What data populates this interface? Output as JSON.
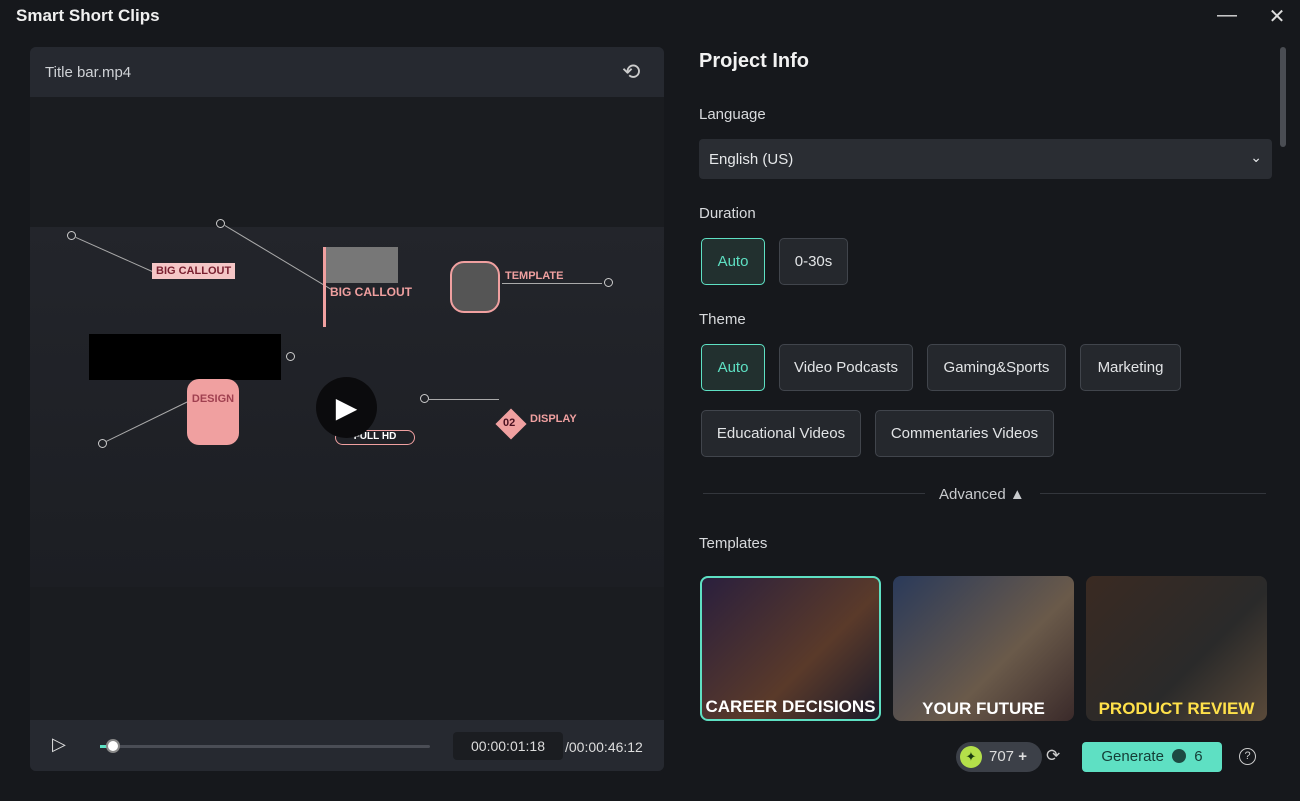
{
  "window": {
    "title": "Smart Short Clips",
    "minimize": "—",
    "close": "✕"
  },
  "preview": {
    "filename": "Title bar.mp4",
    "current_time": "00:00:01:18",
    "total_time": "/00:00:46:12",
    "progress": 0.04,
    "overlay_labels": {
      "callout1": "BIG CALLOUT",
      "callout2": "BIG CALLOUT",
      "template": "TEMPLATE",
      "design": "DESIGN",
      "fullhd": "FULL HD",
      "num": "02",
      "display": "DISPLAY"
    }
  },
  "project": {
    "title": "Project Info",
    "language": {
      "label": "Language",
      "value": "English (US)"
    },
    "duration": {
      "label": "Duration",
      "options": [
        "Auto",
        "0-30s"
      ],
      "selected": "Auto"
    },
    "theme": {
      "label": "Theme",
      "options": [
        "Auto",
        "Video Podcasts",
        "Gaming&Sports",
        "Marketing",
        "Educational Videos",
        "Commentaries Videos"
      ],
      "selected": "Auto"
    },
    "advanced": "Advanced ▲",
    "templates": {
      "label": "Templates",
      "items": [
        {
          "caption": "CAREER DECISIONS"
        },
        {
          "caption": "YOUR FUTURE"
        },
        {
          "caption": "PRODUCT REVIEW"
        }
      ]
    }
  },
  "footer": {
    "credits": "707",
    "generate": "Generate",
    "cost": "6"
  },
  "colors": {
    "accent": "#5ee0c3",
    "pink": "#f0a0a0"
  }
}
